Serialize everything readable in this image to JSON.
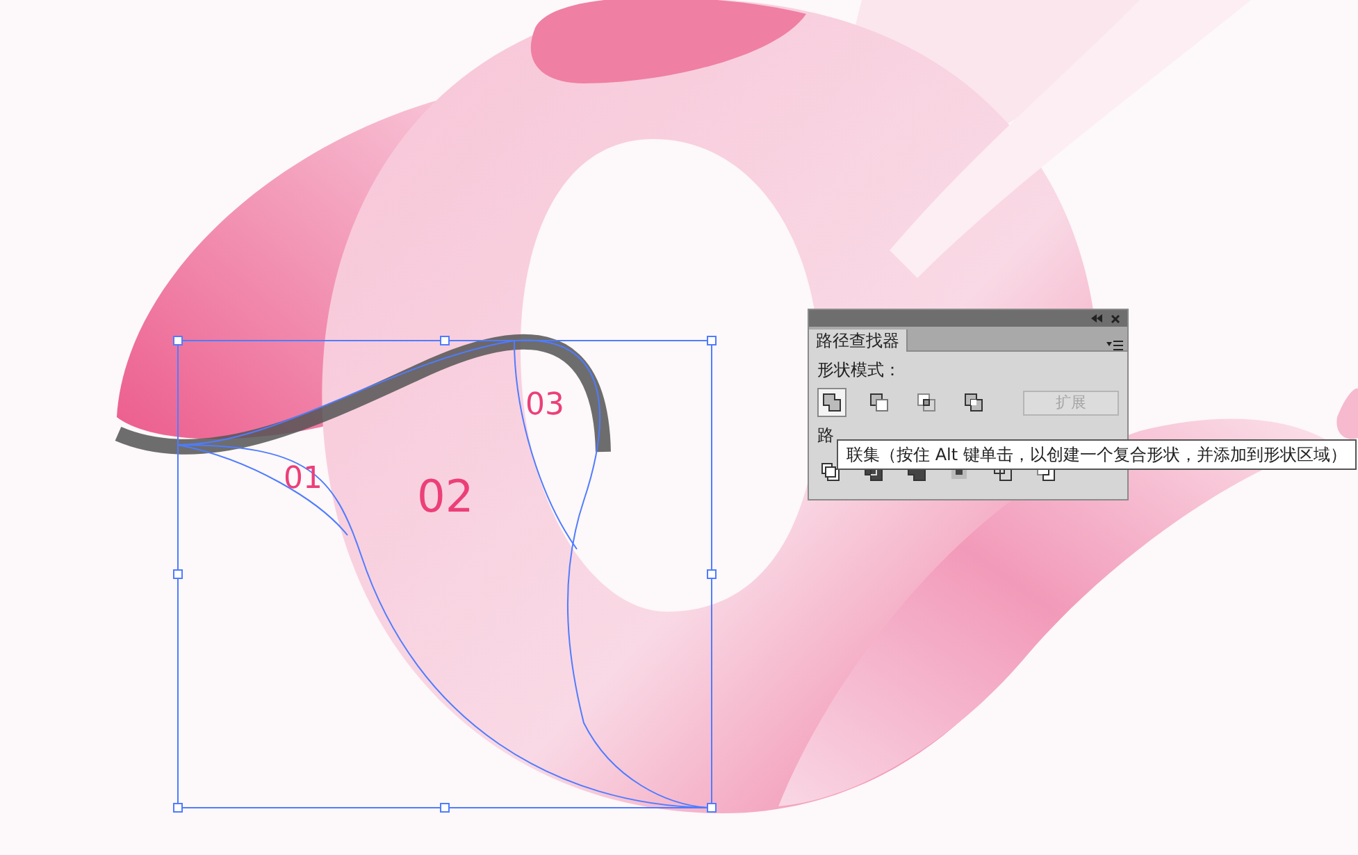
{
  "canvas": {
    "labels": [
      {
        "text": "01"
      },
      {
        "text": "02"
      },
      {
        "text": "03"
      }
    ]
  },
  "panel": {
    "tabs": [
      {
        "label": "路径查找器",
        "selected": true
      }
    ],
    "shape_modes": {
      "title": "形状模式：",
      "buttons": [
        {
          "kind": "unite",
          "selected": true
        },
        {
          "kind": "minus-front",
          "selected": false
        },
        {
          "kind": "intersect",
          "selected": false
        },
        {
          "kind": "exclude",
          "selected": false
        }
      ],
      "expand": {
        "label": "扩展",
        "disabled": true
      }
    },
    "pathfinders": {
      "title": "路",
      "buttons": [
        {
          "kind": "divide"
        },
        {
          "kind": "trim"
        },
        {
          "kind": "merge"
        },
        {
          "kind": "crop"
        },
        {
          "kind": "outline"
        },
        {
          "kind": "minus-back"
        }
      ]
    }
  },
  "tooltip": {
    "text": "联集（按住 Alt 键单击，以创建一个复合形状，并添加到形状区域）"
  }
}
